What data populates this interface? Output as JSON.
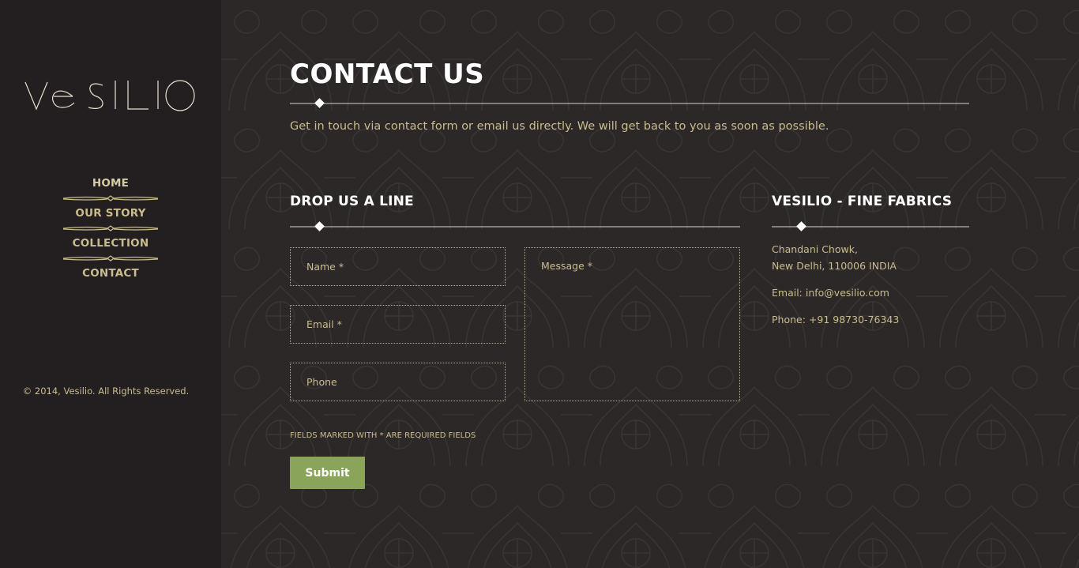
{
  "sidebar": {
    "logo_text": "vesilio",
    "nav": [
      {
        "label": "HOME"
      },
      {
        "label": "OUR STORY"
      },
      {
        "label": "COLLECTION"
      },
      {
        "label": "CONTACT"
      }
    ],
    "copyright": "© 2014, Vesilio. All Rights Reserved."
  },
  "main": {
    "title": "CONTACT US",
    "intro": "Get in touch via contact form or email us directly. We will get back to you as soon as possible.",
    "form": {
      "heading": "DROP US A LINE",
      "name_placeholder": "Name *",
      "email_placeholder": "Email *",
      "phone_placeholder": "Phone",
      "message_placeholder": "Message *",
      "required_note": "FIELDS MARKED WITH * ARE REQUIRED FIELDS",
      "submit_label": "Submit"
    },
    "info": {
      "heading": "VESILIO - FINE FABRICS",
      "address_line1": "Chandani Chowk,",
      "address_line2": "New Delhi, 110006 INDIA",
      "email": "Email: info@vesilio.com",
      "phone": "Phone: +91 98730-76343"
    }
  },
  "colors": {
    "background": "#231f20",
    "main_background": "#2c2828",
    "accent_text": "#c9bc8e",
    "heading": "#ffffff",
    "submit": "#8aa55a"
  }
}
